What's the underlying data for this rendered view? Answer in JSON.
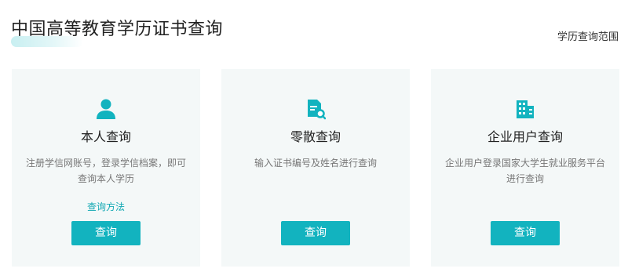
{
  "header": {
    "title": "中国高等教育学历证书查询",
    "scope_link": "学历查询范围"
  },
  "colors": {
    "accent": "#12b3bf",
    "card_bg": "#f4f8f8",
    "link": "#12a8b3"
  },
  "cards": [
    {
      "icon": "user-icon",
      "title": "本人查询",
      "description": "注册学信网账号，登录学信档案，即可查询本人学历",
      "link": "查询方法",
      "button": "查询"
    },
    {
      "icon": "document-search-icon",
      "title": "零散查询",
      "description": "输入证书编号及姓名进行查询",
      "button": "查询"
    },
    {
      "icon": "building-icon",
      "title": "企业用户查询",
      "description": "企业用户登录国家大学生就业服务平台进行查询",
      "button": "查询"
    }
  ]
}
